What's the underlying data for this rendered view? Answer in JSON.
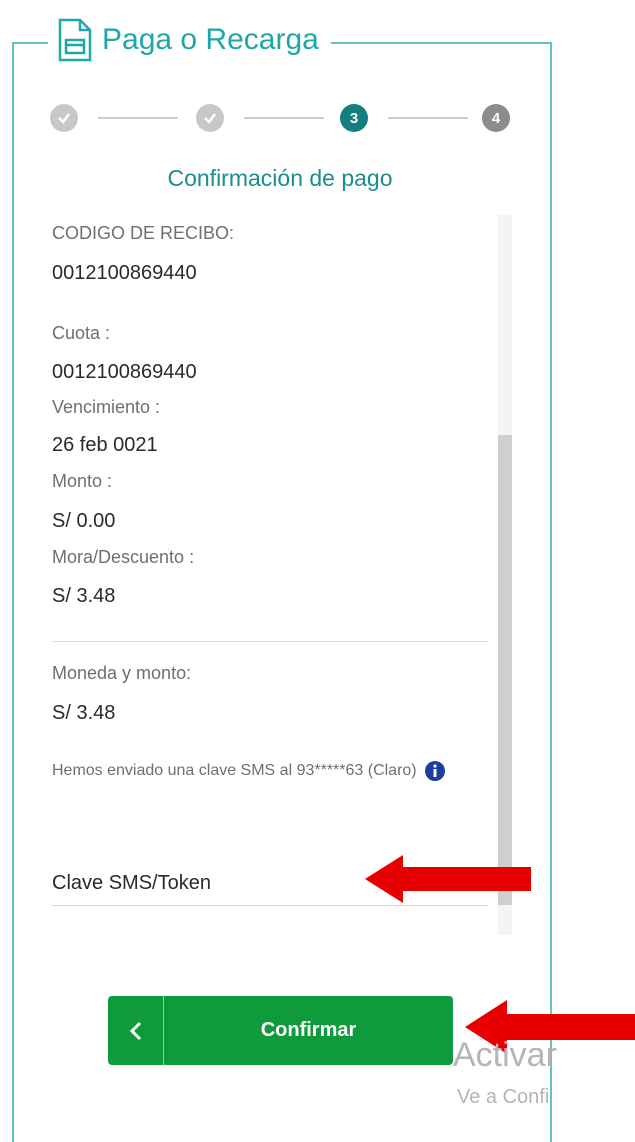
{
  "header": {
    "title": "Paga o Recarga",
    "icon": "card-document-icon"
  },
  "stepper": {
    "steps": [
      {
        "label": "",
        "state": "done"
      },
      {
        "label": "",
        "state": "done"
      },
      {
        "label": "3",
        "state": "current"
      },
      {
        "label": "4",
        "state": "pending"
      }
    ]
  },
  "subtitle": "Confirmación de pago",
  "details": {
    "receipt_code_label": "CODIGO DE RECIBO:",
    "receipt_code_value": "0012100869440",
    "cuota_label": "Cuota :",
    "cuota_value": "0012100869440",
    "vencimiento_label": "Vencimiento :",
    "vencimiento_value": "26 feb 0021",
    "monto_label": "Monto :",
    "monto_value": "S/ 0.00",
    "mora_label": "Mora/Descuento :",
    "mora_value": "S/ 3.48",
    "moneda_label": "Moneda y monto:",
    "moneda_value": "S/ 3.48"
  },
  "sms": {
    "message": "Hemos enviado una clave SMS al 93*****63 (Claro)",
    "input_placeholder": "Clave SMS/Token"
  },
  "actions": {
    "back_icon": "chevron-left-icon",
    "confirm_label": "Confirmar"
  },
  "overlay": {
    "watermark_line1": "Activar",
    "watermark_line2": "Ve a Confi"
  },
  "colors": {
    "accent": "#1ea7a7",
    "button": "#0f9a3c",
    "arrow": "#e60000",
    "step_current": "#137f80"
  }
}
